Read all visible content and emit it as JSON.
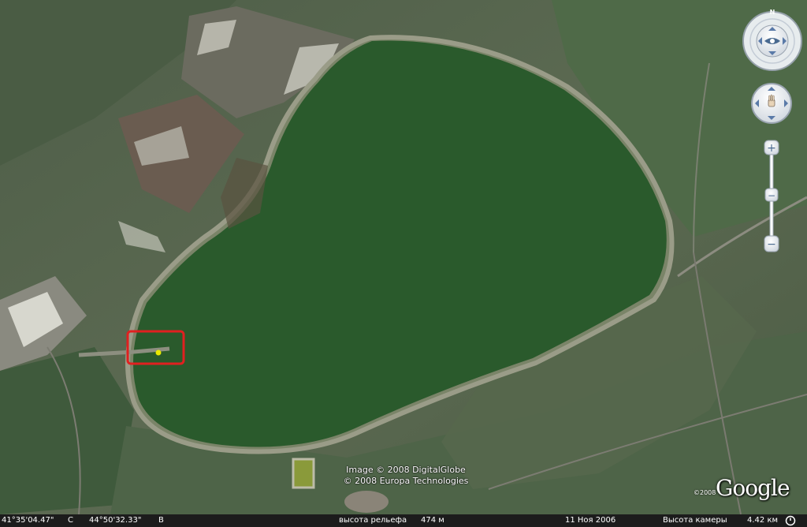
{
  "attribution": {
    "line1": "Image © 2008 DigitalGlobe",
    "line2": "© 2008 Europa Technologies"
  },
  "branding": {
    "logo": "Google",
    "year": "©2008"
  },
  "navigation": {
    "compass_north": "N",
    "look_icon": "eye-icon",
    "move_icon": "hand-icon",
    "zoom_in": "+",
    "zoom_mid": "−",
    "zoom_out": "−",
    "zoom_level": 0.82
  },
  "marker": {
    "color": "#e8e800",
    "highlight_color": "#e02020"
  },
  "status_bar": {
    "latitude": "41°35'04.47\"",
    "latitude_hemisphere": "С",
    "longitude": "44°50'32.33\"",
    "longitude_hemisphere": "В",
    "elevation_label": "высота рельефа",
    "elevation_value": "474 м",
    "imagery_date": "11 Ноя 2006",
    "eye_altitude_label": "Высота камеры",
    "eye_altitude_value": "4.42 км",
    "streaming_icon": "streaming-indicator-icon"
  },
  "colors": {
    "lake": "#2a5a2c",
    "fields": "#5a6a52",
    "status_bg": "#1c1c1c"
  }
}
